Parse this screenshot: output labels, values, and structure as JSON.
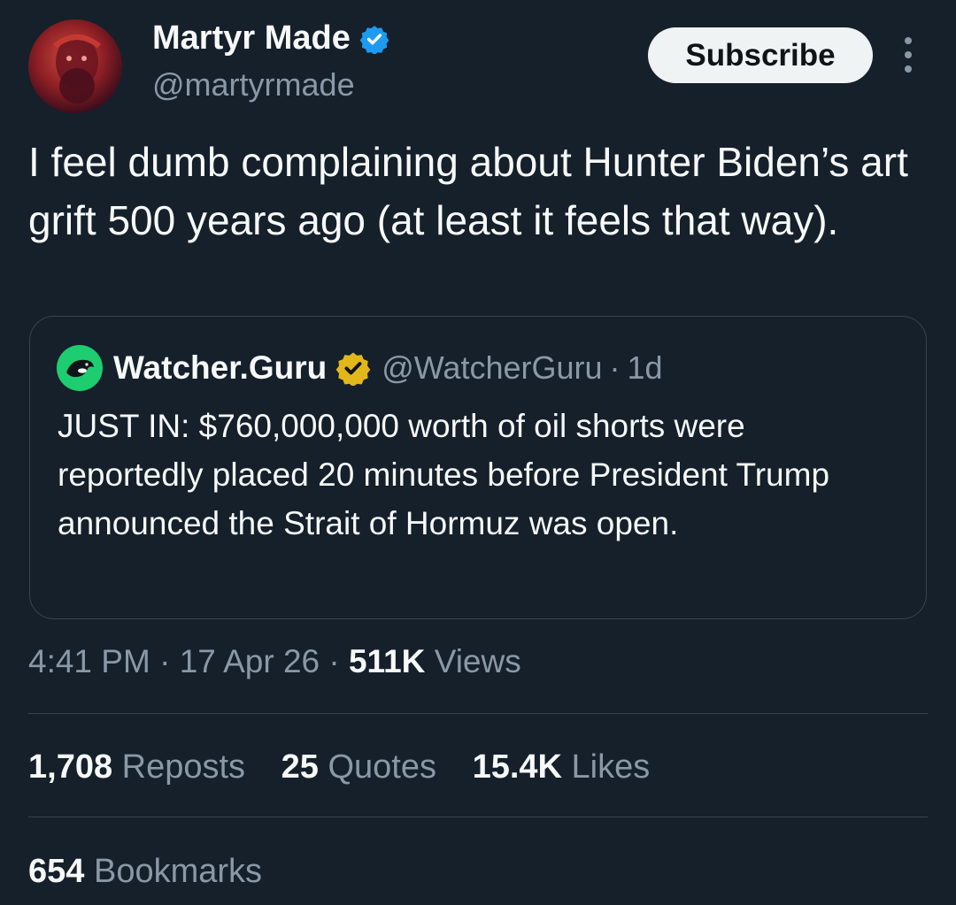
{
  "author": {
    "name": "Martyr Made",
    "handle": "@martyrmade"
  },
  "subscribe_label": "Subscribe",
  "tweet_text": "I feel dumb complaining about Hunter Biden’s art grift 500 years ago (at least it feels that way).",
  "quoted": {
    "name": "Watcher.Guru",
    "handle": "@WatcherGuru",
    "separator": "·",
    "age": "1d",
    "text": "JUST IN: $760,000,000 worth of oil shorts were reportedly placed 20 minutes before President Trump announced the Strait of Hormuz was open."
  },
  "meta": {
    "time": "4:41 PM",
    "date": "17 Apr 26",
    "separator": "·",
    "views_count": "511K",
    "views_label": "Views"
  },
  "stats": {
    "reposts_count": "1,708",
    "reposts_label": "Reposts",
    "quotes_count": "25",
    "quotes_label": "Quotes",
    "likes_count": "15.4K",
    "likes_label": "Likes",
    "bookmarks_count": "654",
    "bookmarks_label": "Bookmarks"
  },
  "colors": {
    "background": "#15202b",
    "text_primary": "#f7f9f9",
    "text_secondary": "#8b98a5",
    "verified_blue": "#1d9bf0",
    "verified_gold": "#e2b719",
    "divider": "#38444d"
  }
}
